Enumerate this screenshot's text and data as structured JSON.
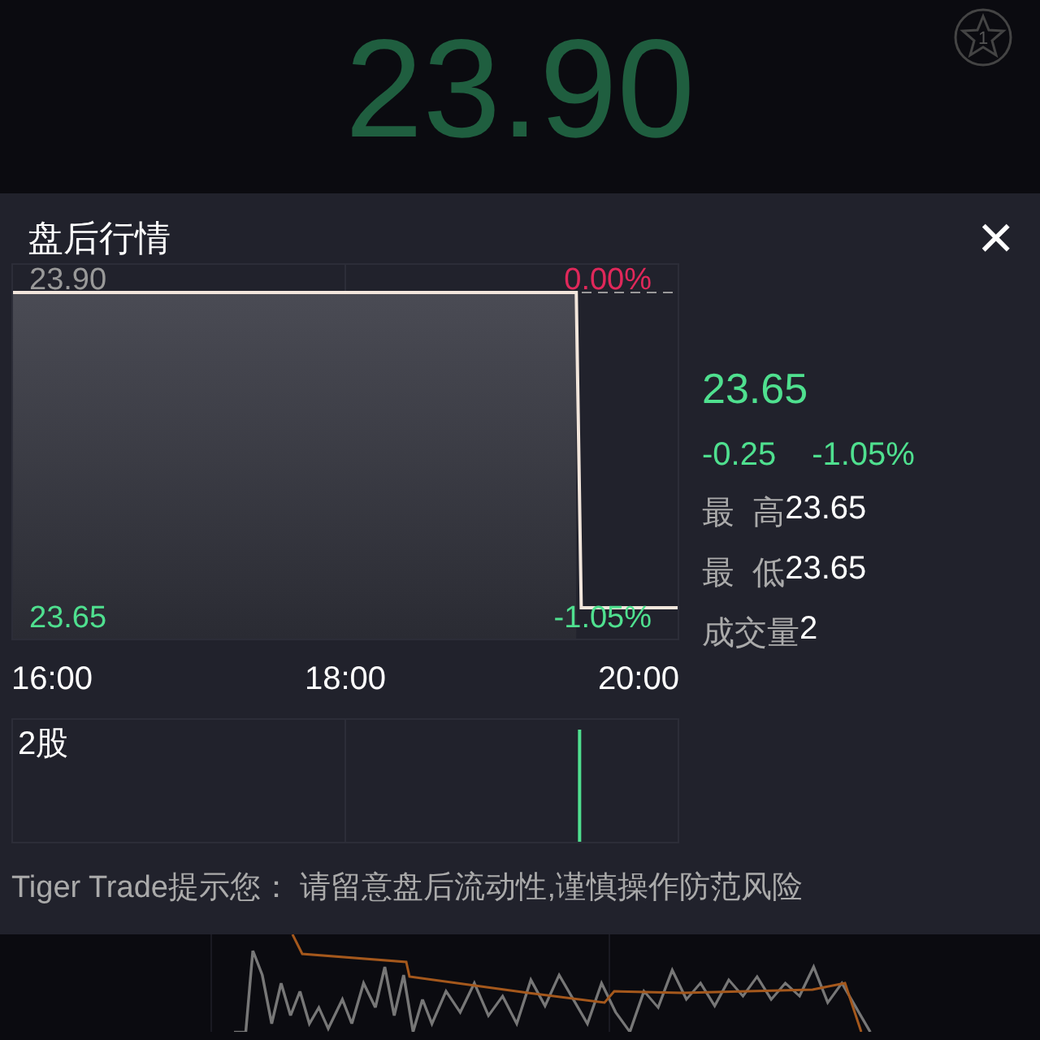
{
  "quote": {
    "price": "23.90",
    "watch_count": "1"
  },
  "panel": {
    "title": "盘后行情",
    "close": "×",
    "price_chart": {
      "left_labels": [
        {
          "label": "23.90",
          "color": "#999999"
        },
        {
          "label": "23.65",
          "color": "#4fe08f"
        }
      ],
      "right_labels": [
        {
          "label": "0.00%",
          "color": "#e0285a"
        },
        {
          "label": "-1.05%",
          "color": "#4fe08f"
        }
      ],
      "time_labels": [
        "16:00",
        "18:00",
        "20:00"
      ]
    },
    "volume_chart": {
      "label": "2股"
    },
    "summary": {
      "price": "23.65",
      "change": "-0.25",
      "change_pct": "-1.05%",
      "stats": [
        {
          "label": "最  高",
          "value": "23.65"
        },
        {
          "label": "最  低",
          "value": "23.65"
        },
        {
          "label": "成交量",
          "value": "2"
        }
      ]
    },
    "notice": "Tiger Trade提示您： 请留意盘后流动性,谨慎操作防范风险"
  }
}
